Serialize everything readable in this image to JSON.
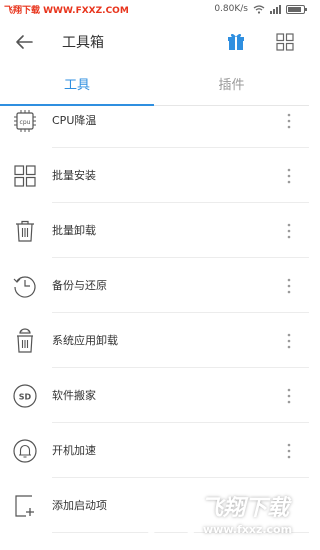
{
  "status_bar": {
    "watermark": "飞翔下载 WWW.FXXZ.COM",
    "speed": "0.80K/s"
  },
  "header": {
    "title": "工具箱",
    "icons": [
      "back-arrow-icon",
      "gift-icon",
      "grid-icon"
    ],
    "accent_color": "#2f8fe0"
  },
  "tabs": [
    {
      "label": "工具",
      "active": true
    },
    {
      "label": "插件",
      "active": false
    }
  ],
  "tools": [
    {
      "label": "CPU降温",
      "icon": "cpu-icon"
    },
    {
      "label": "批量安装",
      "icon": "grid-install-icon"
    },
    {
      "label": "批量卸载",
      "icon": "trash-icon"
    },
    {
      "label": "备份与还原",
      "icon": "clock-restore-icon"
    },
    {
      "label": "系统应用卸载",
      "icon": "android-trash-icon"
    },
    {
      "label": "软件搬家",
      "icon": "sd-card-icon"
    },
    {
      "label": "开机加速",
      "icon": "bell-boost-icon"
    },
    {
      "label": "添加启动项",
      "icon": "add-startup-icon"
    }
  ],
  "watermark_bottom": {
    "title": "飞翔下载",
    "url": "www.fxxz.com"
  }
}
